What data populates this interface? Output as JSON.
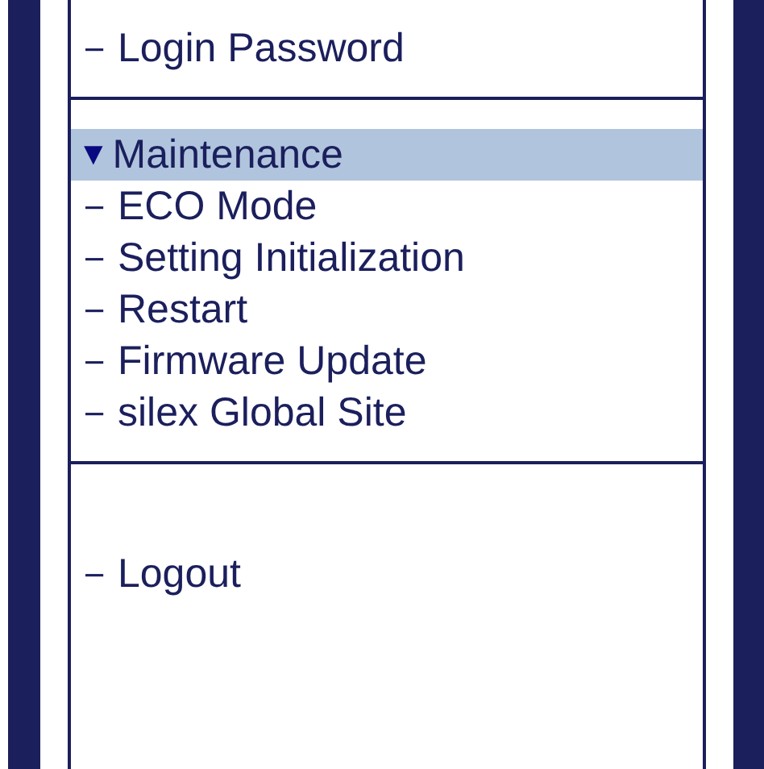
{
  "menu": {
    "sections": [
      {
        "items": [
          {
            "marker": "－",
            "label": "Login Password"
          }
        ]
      },
      {
        "header": {
          "arrow": "▼",
          "label": "Maintenance",
          "selected": true
        },
        "items": [
          {
            "marker": "－",
            "label": "ECO Mode"
          },
          {
            "marker": "－",
            "label": "Setting Initialization"
          },
          {
            "marker": "－",
            "label": "Restart"
          },
          {
            "marker": "－",
            "label": "Firmware Update"
          },
          {
            "marker": "－",
            "label": "silex Global Site"
          }
        ]
      },
      {
        "items": [
          {
            "marker": "－",
            "label": "Logout"
          }
        ]
      }
    ]
  }
}
